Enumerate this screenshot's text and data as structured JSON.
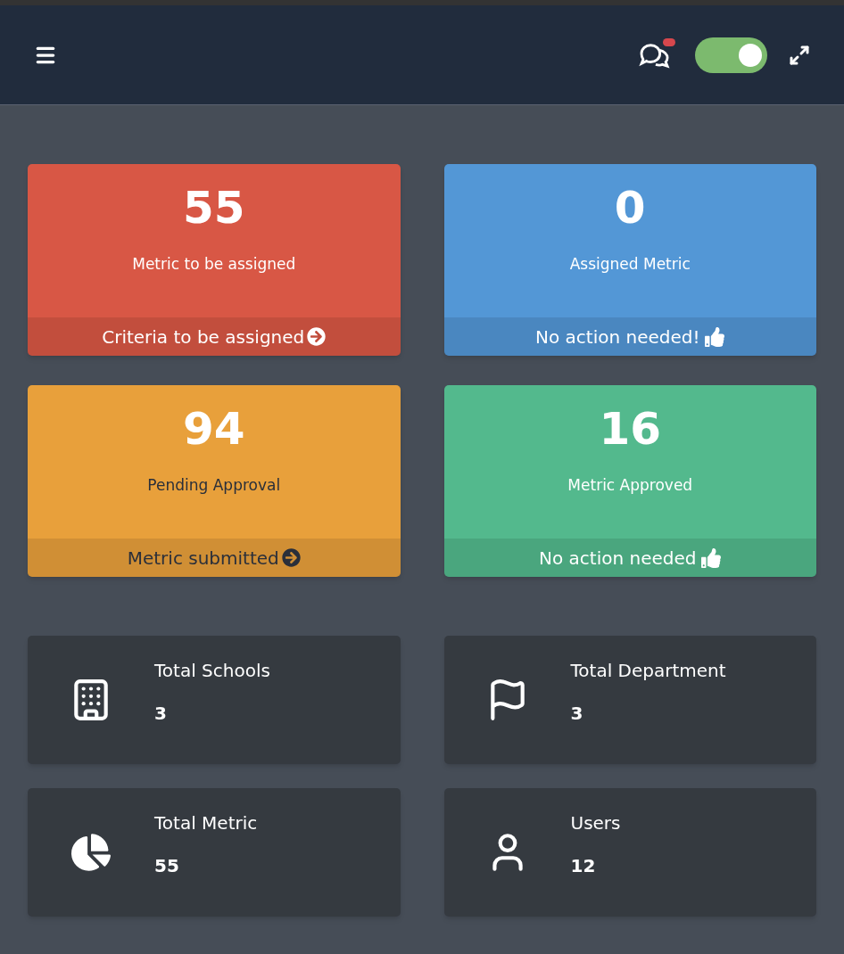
{
  "header": {
    "notification": true,
    "toggle_on": true
  },
  "status_cards": [
    {
      "value": "55",
      "label": "Metric to be assigned",
      "footer": "Criteria to be assigned",
      "kind": "action",
      "color": "#d85745"
    },
    {
      "value": "0",
      "label": "Assigned Metric",
      "footer": "No action needed!",
      "kind": "done",
      "color": "#5397d6"
    },
    {
      "value": "94",
      "label": "Pending Approval",
      "footer": "Metric submitted",
      "kind": "pending",
      "color": "#e8a03b"
    },
    {
      "value": "16",
      "label": "Metric Approved",
      "footer": "No action needed",
      "kind": "done",
      "color": "#53b98d"
    }
  ],
  "totals": [
    {
      "kind": "building",
      "label": "Total Schools",
      "value": "3"
    },
    {
      "kind": "flag",
      "label": "Total Department",
      "value": "3"
    },
    {
      "kind": "pie",
      "label": "Total Metric",
      "value": "55"
    },
    {
      "kind": "user",
      "label": "Users",
      "value": "12"
    }
  ]
}
